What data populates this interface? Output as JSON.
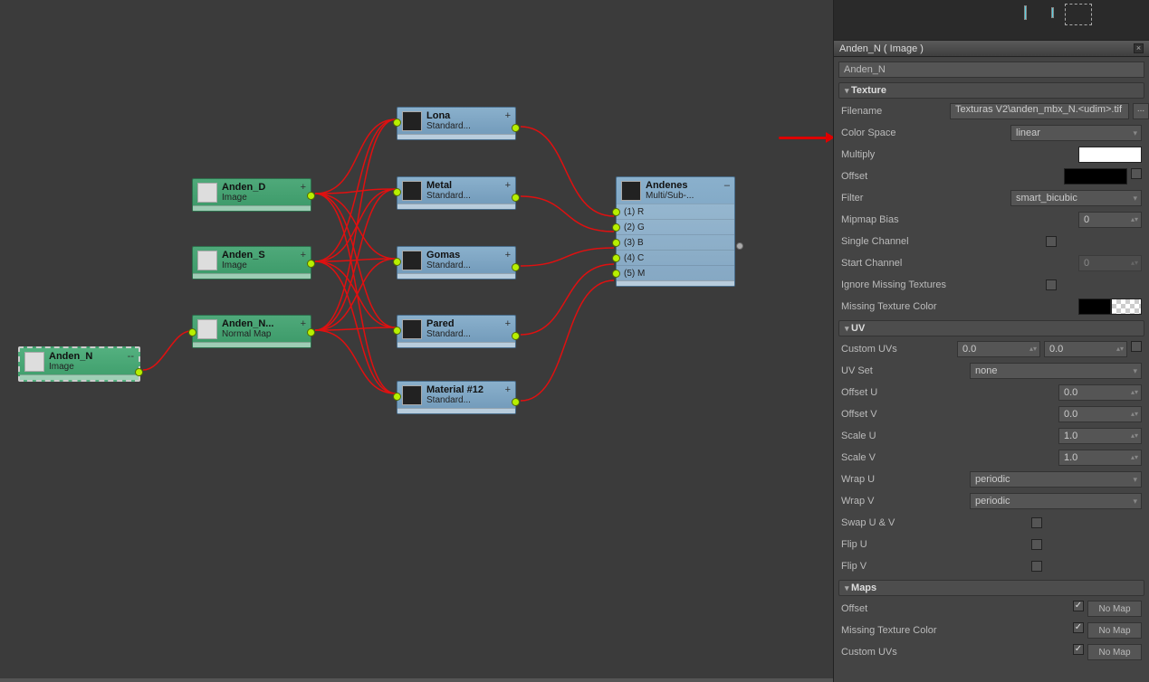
{
  "nodes": {
    "anden_n_sel": {
      "title": "Anden_N",
      "sub": "Image"
    },
    "anden_d": {
      "title": "Anden_D",
      "sub": "Image"
    },
    "anden_s": {
      "title": "Anden_S",
      "sub": "Image"
    },
    "anden_nmap": {
      "title": "Anden_N...",
      "sub": "Normal Map"
    },
    "lona": {
      "title": "Lona",
      "sub": "Standard..."
    },
    "metal": {
      "title": "Metal",
      "sub": "Standard..."
    },
    "gomas": {
      "title": "Gomas",
      "sub": "Standard..."
    },
    "pared": {
      "title": "Pared",
      "sub": "Standard..."
    },
    "mat12": {
      "title": "Material #12",
      "sub": "Standard..."
    },
    "andenes": {
      "title": "Andenes",
      "sub": "Multi/Sub-...",
      "rows": [
        "(1) R",
        "(2) G",
        "(3) B",
        "(4) C",
        "(5) M"
      ]
    }
  },
  "panel": {
    "title": "Anden_N  ( Image )",
    "name": "Anden_N",
    "sections": {
      "texture": {
        "header": "Texture",
        "filename_label": "Filename",
        "filename": "Texturas V2\\anden_mbx_N.<udim>.tif",
        "colorspace_label": "Color Space",
        "colorspace": "linear",
        "multiply_label": "Multiply",
        "offset_label": "Offset",
        "filter_label": "Filter",
        "filter": "smart_bicubic",
        "mipmap_label": "Mipmap Bias",
        "mipmap": "0",
        "single_ch_label": "Single Channel",
        "start_ch_label": "Start Channel",
        "start_ch": "0",
        "ignore_miss_label": "Ignore Missing Textures",
        "miss_color_label": "Missing Texture Color"
      },
      "uv": {
        "header": "UV",
        "custom_uvs_label": "Custom UVs",
        "custom_uvs_x": "0.0",
        "custom_uvs_y": "0.0",
        "uvset_label": "UV Set",
        "uvset": "none",
        "offu_label": "Offset U",
        "offu": "0.0",
        "offv_label": "Offset V",
        "offv": "0.0",
        "scaleu_label": "Scale U",
        "scaleu": "1.0",
        "scalev_label": "Scale V",
        "scalev": "1.0",
        "wrapu_label": "Wrap U",
        "wrapu": "periodic",
        "wrapv_label": "Wrap V",
        "wrapv": "periodic",
        "swap_label": "Swap U & V",
        "flipu_label": "Flip U",
        "flipv_label": "Flip V"
      },
      "maps": {
        "header": "Maps",
        "offset_label": "Offset",
        "miss_tex_label": "Missing Texture Color",
        "custom_uvs_label": "Custom UVs",
        "nomap": "No Map"
      }
    }
  }
}
